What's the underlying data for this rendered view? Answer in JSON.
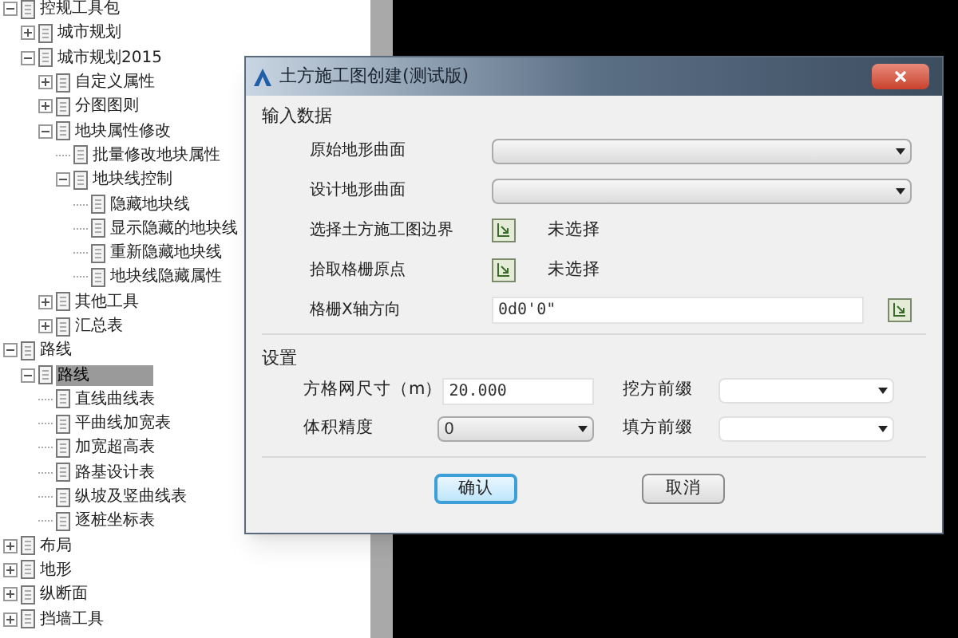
{
  "tree": {
    "items": [
      {
        "label": "控规工具包",
        "expanded": true,
        "selected": false,
        "children": [
          {
            "label": "城市规划",
            "expanded": false,
            "selected": false
          },
          {
            "label": "城市规划2015",
            "expanded": true,
            "selected": false,
            "children": [
              {
                "label": "自定义属性",
                "expanded": false,
                "selected": false
              },
              {
                "label": "分图图则",
                "expanded": false,
                "selected": false
              },
              {
                "label": "地块属性修改",
                "expanded": true,
                "selected": false,
                "children": [
                  {
                    "label": "批量修改地块属性",
                    "selected": false
                  },
                  {
                    "label": "地块线控制",
                    "expanded": true,
                    "selected": false,
                    "children": [
                      {
                        "label": "隐藏地块线",
                        "selected": false
                      },
                      {
                        "label": "显示隐藏的地块线",
                        "selected": false
                      },
                      {
                        "label": "重新隐藏地块线",
                        "selected": false
                      },
                      {
                        "label": "地块线隐藏属性",
                        "selected": false
                      }
                    ]
                  }
                ]
              },
              {
                "label": "其他工具",
                "expanded": false,
                "selected": false
              },
              {
                "label": "汇总表",
                "expanded": false,
                "selected": false
              }
            ]
          }
        ]
      },
      {
        "label": "路线",
        "expanded": true,
        "selected": false,
        "children": [
          {
            "label": "路线",
            "expanded": true,
            "selected": true,
            "children": [
              {
                "label": "直线曲线表",
                "selected": false
              },
              {
                "label": "平曲线加宽表",
                "selected": false
              },
              {
                "label": "加宽超高表",
                "selected": false
              },
              {
                "label": "路基设计表",
                "selected": false
              },
              {
                "label": "纵坡及竖曲线表",
                "selected": false
              },
              {
                "label": "逐桩坐标表",
                "selected": false
              }
            ]
          }
        ]
      },
      {
        "label": "布局",
        "expanded": false,
        "selected": false
      },
      {
        "label": "地形",
        "expanded": false,
        "selected": false
      },
      {
        "label": "纵断面",
        "expanded": false,
        "selected": false
      },
      {
        "label": "挡墙工具",
        "expanded": false,
        "selected": false
      }
    ]
  },
  "dialog": {
    "title": "土方施工图创建(测试版)",
    "input_section": {
      "title": "输入数据",
      "rows": [
        {
          "kind": "dropdown",
          "label": "原始地形曲面"
        },
        {
          "kind": "dropdown",
          "label": "设计地形曲面"
        },
        {
          "kind": "pick",
          "label": "选择土方施工图边界",
          "status": "未选择"
        },
        {
          "kind": "pick",
          "label": "拾取格栅原点",
          "status": "未选择"
        },
        {
          "kind": "text",
          "label": "格栅X轴方向",
          "value": "0d0'0\""
        }
      ]
    },
    "settings_section": {
      "title": "设置",
      "fields": [
        {
          "kind": "text",
          "label": "方格网尺寸（m）",
          "value": "20.000"
        },
        {
          "kind": "combo",
          "label": "挖方前缀"
        },
        {
          "kind": "dropdown",
          "label": "体积精度",
          "value": "0"
        },
        {
          "kind": "combo",
          "label": "填方前缀"
        }
      ]
    },
    "buttons": [
      {
        "label": "确认",
        "default": true
      },
      {
        "label": "取消",
        "default": false
      }
    ]
  }
}
